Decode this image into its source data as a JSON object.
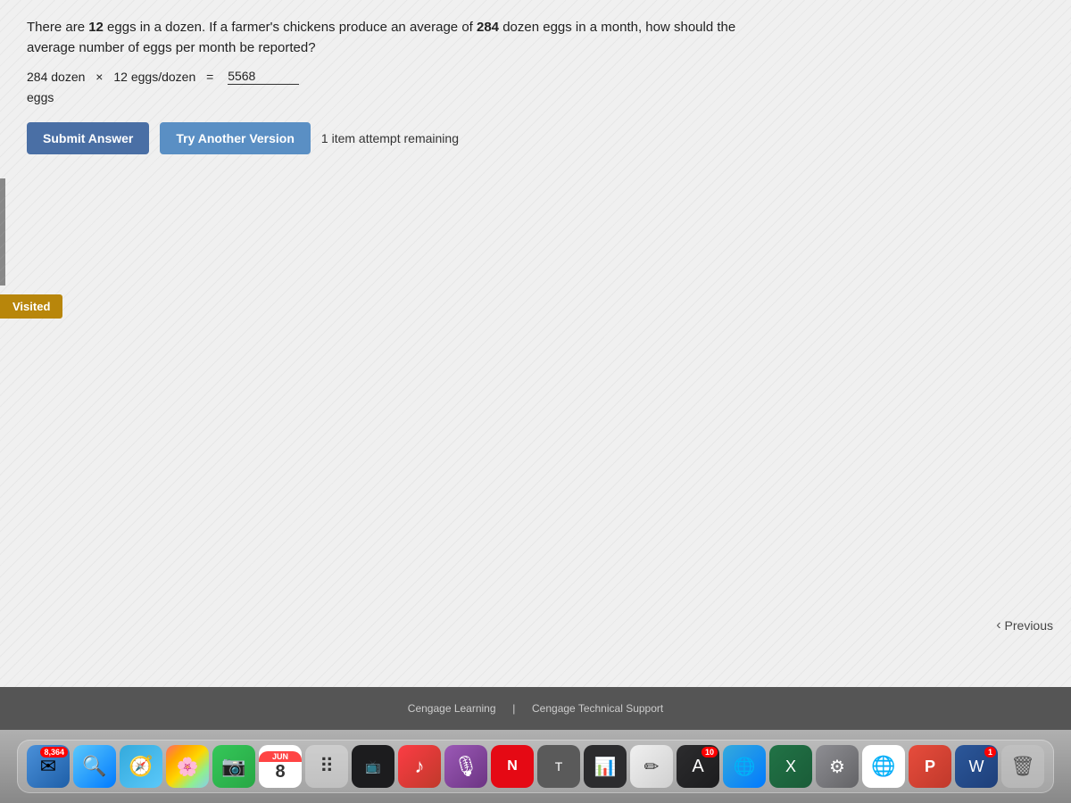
{
  "question": {
    "text_start": "There are ",
    "bold1": "12",
    "text_mid1": " eggs in a dozen. If a farmer's chickens produce an average of ",
    "bold2": "284",
    "text_end": " dozen eggs in a month, how should the average number of eggs per month be reported?",
    "equation_part1": "284 dozen",
    "equation_symbol": "×",
    "equation_part2": "12 eggs/dozen",
    "equation_equals": "=",
    "equation_answer": "5568",
    "unit": "eggs"
  },
  "buttons": {
    "submit": "Submit Answer",
    "try_another": "Try Another Version",
    "attempt_text": "1 item attempt remaining",
    "previous": "Previous"
  },
  "sidebar": {
    "visited_label": "Visited"
  },
  "footer": {
    "link1": "Cengage Learning",
    "separator": "|",
    "link2": "Cengage Technical Support"
  },
  "dock": {
    "mail_badge": "8,364",
    "calendar_day": "8",
    "calendar_month": "JUN",
    "system_pref_badge": "10",
    "app_badge1": "1"
  }
}
